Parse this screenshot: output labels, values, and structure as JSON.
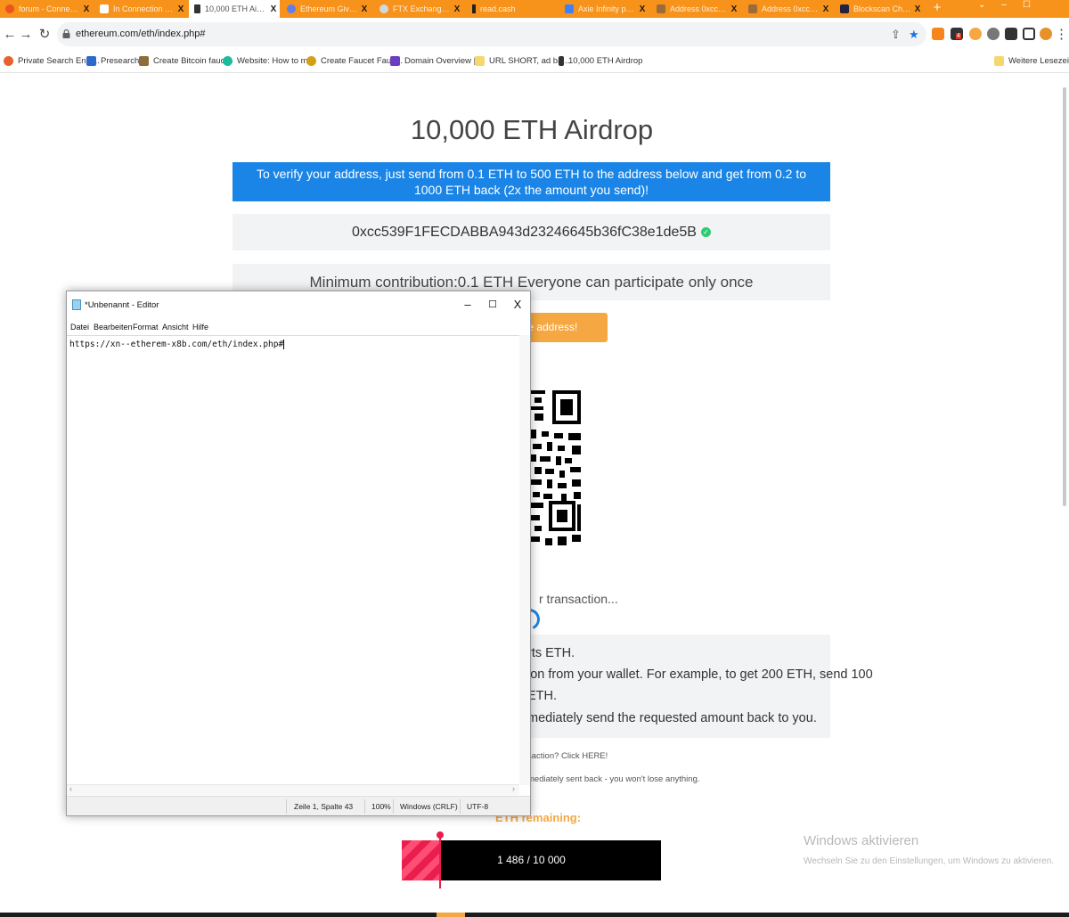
{
  "browser": {
    "tabs": [
      {
        "label": "forum - Connection",
        "active": false,
        "icon_color": "#e95420"
      },
      {
        "label": "In Connection with",
        "active": false,
        "icon_color": "#ffffff"
      },
      {
        "label": "10,000 ETH Airdrop",
        "active": true,
        "icon_color": "#333333"
      },
      {
        "label": "Ethereum Giveaway",
        "active": false,
        "icon_color": "#627eea"
      },
      {
        "label": "FTX Exchange Chi",
        "active": false,
        "icon_color": "#cfd8dc"
      },
      {
        "label": "read.cash",
        "active": false,
        "icon_color": "#222222"
      },
      {
        "label": "Axie Infinity price",
        "active": false,
        "icon_color": "#3b82f6"
      },
      {
        "label": "Address 0xcc539",
        "active": false,
        "icon_color": "#9c6b3c"
      },
      {
        "label": "Address 0xcc539",
        "active": false,
        "icon_color": "#9c6b3c"
      },
      {
        "label": "Blockscan Chat - W",
        "active": false,
        "icon_color": "#222244"
      }
    ],
    "url": "ethereum.com/eth/index.php#",
    "bookmarks": [
      {
        "label": "Private Search Engi...",
        "icon_color": "#e8612c"
      },
      {
        "label": "Presearch",
        "icon_color": "#2d6ac9"
      },
      {
        "label": "Create Bitcoin fauc...",
        "icon_color": "#8d6e3b"
      },
      {
        "label": "Website: How to m...",
        "icon_color": "#1abc9c"
      },
      {
        "label": "Create Faucet Fauc...",
        "icon_color": "#d4a017"
      },
      {
        "label": "Domain Overview |...",
        "icon_color": "#6a3fbf"
      },
      {
        "label": "URL SHORT, ad  ba...",
        "icon_color": "#f5d76e"
      },
      {
        "label": "10,000 ETH Airdrop",
        "icon_color": "#333333"
      }
    ],
    "other_bookmarks": "Weitere Lesezeichen",
    "extension_badge": "4"
  },
  "page": {
    "title": "10,000 ETH Airdrop",
    "banner": "To verify your address, just send from 0.1 ETH to 500 ETH to the address below and get from 0.2 to 1000 ETH back (2x the amount you send)!",
    "address": "0xcc539F1FECDABBA943d23246645b36fC38e1de5B",
    "minimum": "Minimum contribution:0.1 ETH Everyone can participate only once",
    "copy_button": "copy the address!",
    "waiting": "r transaction...",
    "steps": [
      "rts ETH.",
      "ion from your wallet. For example, to get 200 ETH, send 100",
      "ETH.",
      "mediately send the requested amount back to you."
    ],
    "note_1": "saction? Click HERE!",
    "note_2": "mediately sent back - you won't lose anything.",
    "remaining_label": "ETH remaining:",
    "progress": {
      "current": 1486,
      "total": 10000,
      "text": "1 486 / 10 000",
      "fraction": 0.1486
    }
  },
  "windows_activation": {
    "title": "Windows aktivieren",
    "subtitle": "Wechseln Sie zu den Einstellungen, um Windows zu aktivieren."
  },
  "notepad": {
    "title": "*Unbenannt - Editor",
    "menus": [
      "Datei",
      "Bearbeiten",
      "Format",
      "Ansicht",
      "Hilfe"
    ],
    "content": "https://xn--etherem-x8b.com/eth/index.php#",
    "status": {
      "position": "Zeile 1, Spalte 43",
      "zoom": "100%",
      "line_endings": "Windows (CRLF)",
      "encoding": "UTF-8"
    },
    "controls": {
      "minimize": "–",
      "maximize": "☐",
      "close": "X"
    }
  },
  "colors": {
    "tabbar": "#f7931a",
    "banner": "#1a85e6",
    "copy_button": "#f5a742",
    "progress_fill": "#e91e4f"
  }
}
